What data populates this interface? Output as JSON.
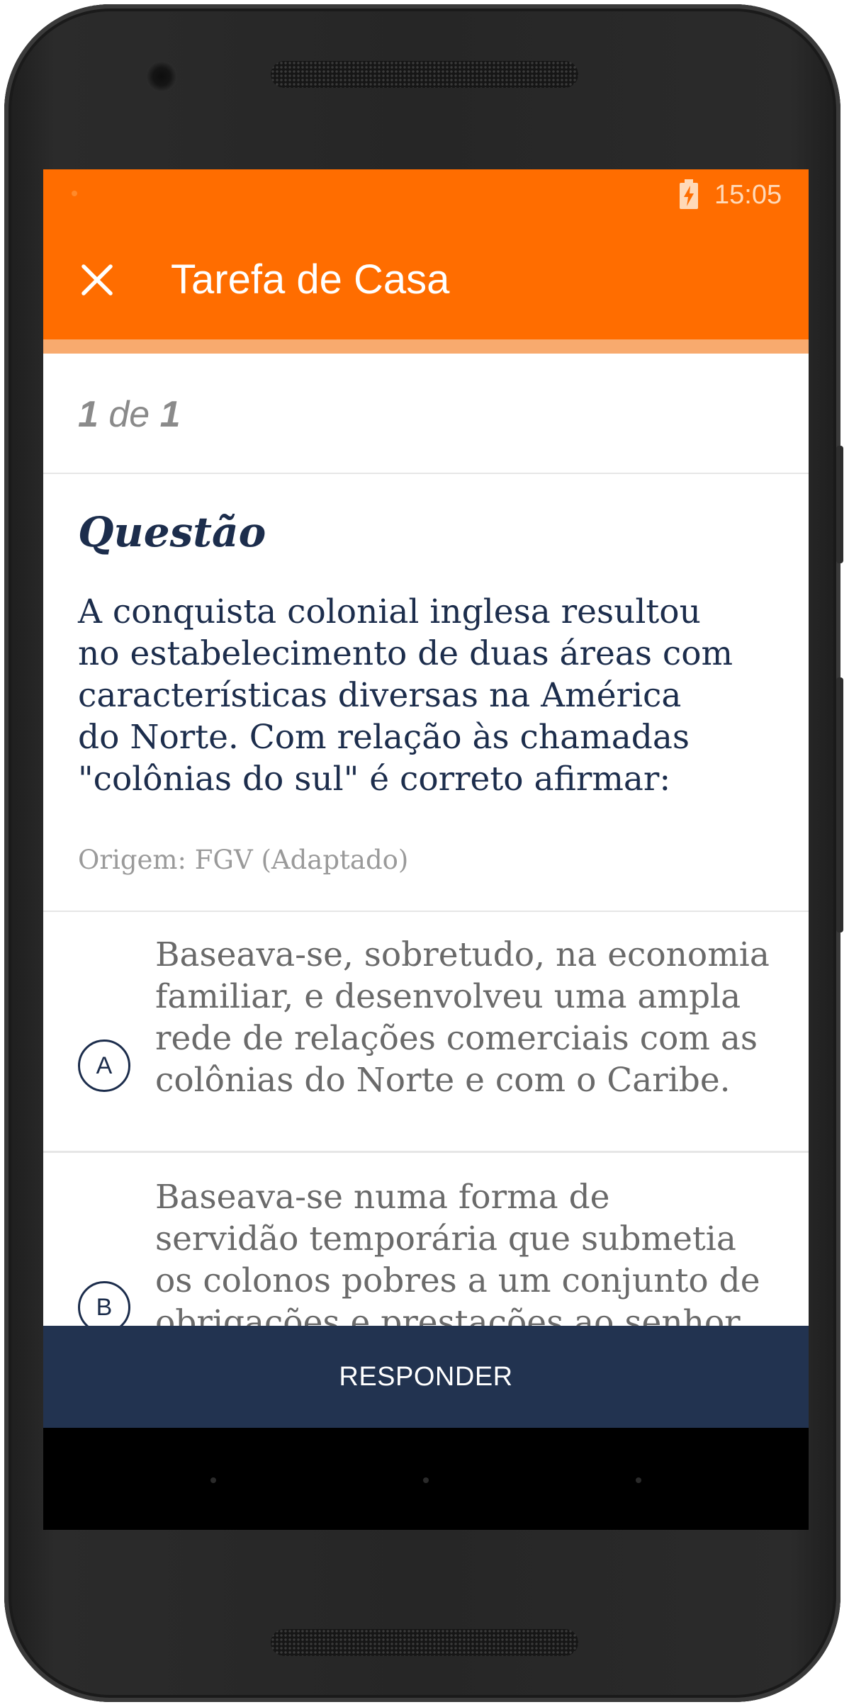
{
  "status_bar": {
    "time": "15:05",
    "battery_icon": "battery-charging-icon"
  },
  "app_bar": {
    "title": "Tarefa de Casa",
    "close_icon": "close-icon"
  },
  "progress": {
    "current": "1",
    "separator": "de",
    "total": "1"
  },
  "question": {
    "heading": "Questão",
    "text": "A conquista colonial inglesa resultou\nno estabelecimento de duas áreas com\ncaracterísticas diversas na América\ndo Norte. Com relação às chamadas\n\"colônias do sul\" é correto afirmar:",
    "origin": "Origem: FGV (Adaptado)"
  },
  "options": [
    {
      "letter": "A",
      "text": "Baseava-se, sobretudo, na economia\nfamiliar, e desenvolveu uma ampla\nrede de relações comerciais com as\ncolônias do Norte e com o Caribe."
    },
    {
      "letter": "B",
      "text": "Baseava-se numa forma de\nservidão temporária que submetia\nos colonos pobres a um conjunto de\nobrigações e prestações ao senhor"
    }
  ],
  "action": {
    "respond_label": "RESPONDER"
  },
  "colors": {
    "accent": "#ff6d00",
    "primary_dark": "#223350",
    "text_navy": "#1c2d4c"
  }
}
